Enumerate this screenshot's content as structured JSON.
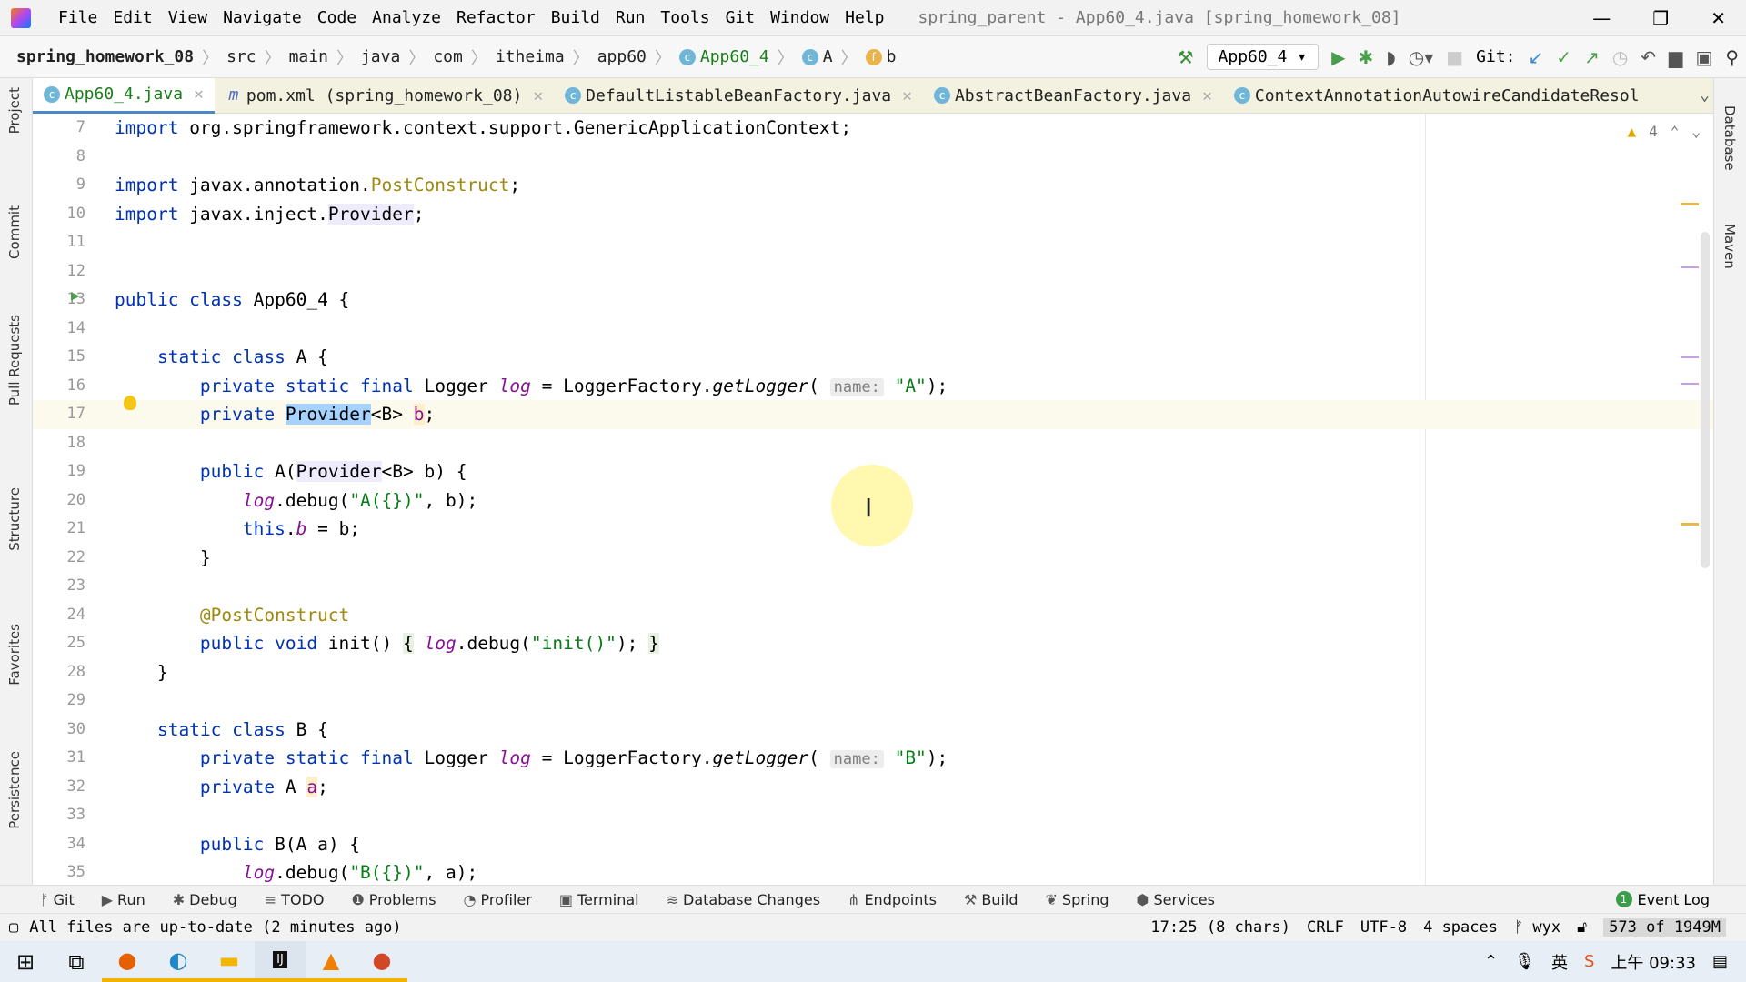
{
  "titlebar": {
    "menu": [
      "File",
      "Edit",
      "View",
      "Navigate",
      "Code",
      "Analyze",
      "Refactor",
      "Build",
      "Run",
      "Tools",
      "Git",
      "Window",
      "Help"
    ],
    "title": "spring_parent - App60_4.java [spring_homework_08]"
  },
  "navbar": {
    "breadcrumb": [
      "spring_homework_08",
      "src",
      "main",
      "java",
      "com",
      "itheima",
      "app60",
      "App60_4",
      "A",
      "b"
    ],
    "run_config": "App60_4",
    "git_label": "Git:"
  },
  "tabs": [
    {
      "label": "App60_4.java",
      "active": true
    },
    {
      "label": "pom.xml (spring_homework_08)"
    },
    {
      "label": "DefaultListableBeanFactory.java"
    },
    {
      "label": "AbstractBeanFactory.java"
    },
    {
      "label": "ContextAnnotationAutowireCandidateResol"
    }
  ],
  "left_tools": [
    "Project",
    "Commit",
    "Pull Requests",
    "Structure",
    "Favorites",
    "Persistence"
  ],
  "right_tools": [
    "Database",
    "Maven"
  ],
  "inspections": {
    "warnings": "4"
  },
  "editor": {
    "current_line": 17,
    "lines": [
      {
        "n": "7",
        "t": [
          [
            "import",
            "kw"
          ],
          [
            " org.springframework.context.support.GenericApplicationContext;",
            ""
          ]
        ]
      },
      {
        "n": "8",
        "t": []
      },
      {
        "n": "9",
        "t": [
          [
            "import",
            "kw"
          ],
          [
            " javax.annotation.",
            ""
          ],
          [
            "PostConstruct",
            "ann"
          ],
          [
            ";",
            ""
          ]
        ]
      },
      {
        "n": "10",
        "t": [
          [
            "import",
            "kw"
          ],
          [
            " javax.inject.",
            ""
          ],
          [
            "Provider",
            "ref"
          ],
          [
            ";",
            ""
          ]
        ]
      },
      {
        "n": "11",
        "t": []
      },
      {
        "n": "12",
        "t": []
      },
      {
        "n": "13",
        "t": [
          [
            "public class",
            "kw"
          ],
          [
            " App60_4 {",
            ""
          ]
        ]
      },
      {
        "n": "14",
        "t": []
      },
      {
        "n": "15",
        "t": [
          [
            "    static class",
            "kw"
          ],
          [
            " A {",
            ""
          ]
        ]
      },
      {
        "n": "16",
        "t": [
          [
            "        private static final",
            "kw"
          ],
          [
            " Logger ",
            ""
          ],
          [
            "log",
            "fld"
          ],
          [
            " = LoggerFactory.",
            ""
          ],
          [
            "getLogger",
            "it"
          ],
          [
            "( ",
            ""
          ],
          [
            "name:",
            "hint"
          ],
          [
            " ",
            ""
          ],
          [
            "\"A\"",
            "str"
          ],
          [
            ");",
            ""
          ]
        ]
      },
      {
        "n": "17",
        "t": [
          [
            "        private",
            "kw"
          ],
          [
            " ",
            ""
          ],
          [
            "Provider",
            "sel"
          ],
          [
            "<B> ",
            ""
          ],
          [
            "b",
            "fld2"
          ],
          [
            ";",
            ""
          ]
        ]
      },
      {
        "n": "18",
        "t": []
      },
      {
        "n": "19",
        "t": [
          [
            "        public",
            "kw"
          ],
          [
            " A(",
            ""
          ],
          [
            "Provider",
            "ref"
          ],
          [
            "<B> b) {",
            ""
          ]
        ]
      },
      {
        "n": "20",
        "t": [
          [
            "            ",
            ""
          ],
          [
            "log",
            "fld"
          ],
          [
            ".debug(",
            ""
          ],
          [
            "\"A({})\"",
            "str"
          ],
          [
            ", b);",
            ""
          ]
        ]
      },
      {
        "n": "21",
        "t": [
          [
            "            this",
            "kw"
          ],
          [
            ".",
            ""
          ],
          [
            "b",
            "fld"
          ],
          [
            " = b;",
            ""
          ]
        ]
      },
      {
        "n": "22",
        "t": [
          [
            "        }",
            ""
          ]
        ]
      },
      {
        "n": "23",
        "t": []
      },
      {
        "n": "24",
        "t": [
          [
            "        @PostConstruct",
            "ann"
          ]
        ]
      },
      {
        "n": "25",
        "t": [
          [
            "        public void",
            "kw"
          ],
          [
            " init() ",
            ""
          ],
          [
            "{",
            "brace"
          ],
          [
            " ",
            ""
          ],
          [
            "log",
            "fld"
          ],
          [
            ".debug(",
            ""
          ],
          [
            "\"init()\"",
            "str"
          ],
          [
            "); ",
            ""
          ],
          [
            "}",
            "brace"
          ]
        ]
      },
      {
        "n": "28",
        "t": [
          [
            "    }",
            ""
          ]
        ]
      },
      {
        "n": "29",
        "t": []
      },
      {
        "n": "30",
        "t": [
          [
            "    static class",
            "kw"
          ],
          [
            " B {",
            ""
          ]
        ]
      },
      {
        "n": "31",
        "t": [
          [
            "        private static final",
            "kw"
          ],
          [
            " Logger ",
            ""
          ],
          [
            "log",
            "fld"
          ],
          [
            " = LoggerFactory.",
            ""
          ],
          [
            "getLogger",
            "it"
          ],
          [
            "( ",
            ""
          ],
          [
            "name:",
            "hint"
          ],
          [
            " ",
            ""
          ],
          [
            "\"B\"",
            "str"
          ],
          [
            ");",
            ""
          ]
        ]
      },
      {
        "n": "32",
        "t": [
          [
            "        private",
            "kw"
          ],
          [
            " A ",
            ""
          ],
          [
            "a",
            "fld2"
          ],
          [
            ";",
            ""
          ]
        ]
      },
      {
        "n": "33",
        "t": []
      },
      {
        "n": "34",
        "t": [
          [
            "        public",
            "kw"
          ],
          [
            " B(A a) {",
            ""
          ]
        ]
      },
      {
        "n": "35",
        "t": [
          [
            "            ",
            ""
          ],
          [
            "log",
            "fld"
          ],
          [
            ".debug(",
            ""
          ],
          [
            "\"B({})\"",
            "str"
          ],
          [
            ", a);",
            ""
          ]
        ]
      }
    ]
  },
  "toolwindows": [
    "Git",
    "Run",
    "Debug",
    "TODO",
    "Problems",
    "Profiler",
    "Terminal",
    "Database Changes",
    "Endpoints",
    "Build",
    "Spring",
    "Services"
  ],
  "event_log": {
    "label": "Event Log",
    "count": "1"
  },
  "status": {
    "message": "All files are up-to-date (2 minutes ago)",
    "position": "17:25 (8 chars)",
    "line_sep": "CRLF",
    "encoding": "UTF-8",
    "indent": "4 spaces",
    "branch": "wyx",
    "memory": "573 of 1949M"
  },
  "taskbar": {
    "time": "上午 09:33",
    "ime": "英"
  },
  "colors": {
    "keyword": "#0033b3",
    "string": "#067d17",
    "field": "#871094",
    "annotation": "#9e880d",
    "selection": "#a6d2ff"
  }
}
